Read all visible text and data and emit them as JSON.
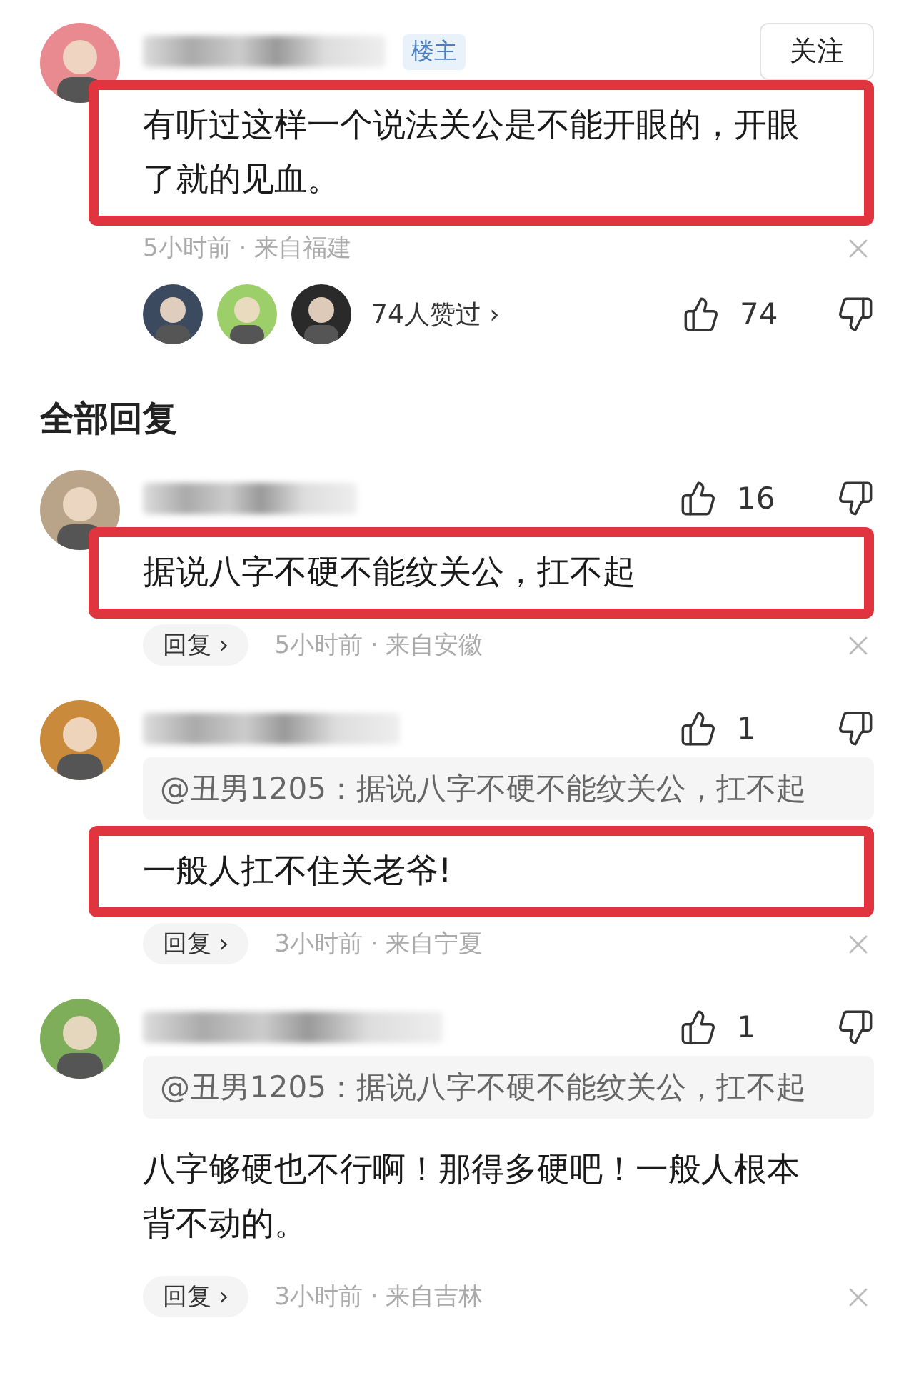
{
  "post": {
    "badge": "楼主",
    "follow_button": "关注",
    "text": "有听过这样一个说法关公是不能开眼的，开眼了就的见血。",
    "highlighted": true,
    "meta": "5小时前 · 来自福建",
    "likers_text": "74人赞过 ›",
    "likes": "74"
  },
  "section_title": "全部回复",
  "replies": [
    {
      "likes": "16",
      "text": "据说八字不硬不能纹关公，扛不起",
      "highlighted": true,
      "reply_button": "回复 ›",
      "meta": "5小时前 · 来自安徽"
    },
    {
      "likes": "1",
      "quote": "@丑男1205：据说八字不硬不能纹关公，扛不起",
      "text": "一般人扛不住关老爷!",
      "highlighted": true,
      "reply_button": "回复 ›",
      "meta": "3小时前 · 来自宁夏"
    },
    {
      "likes": "1",
      "quote": "@丑男1205：据说八字不硬不能纹关公，扛不起",
      "text": "八字够硬也不行啊！那得多硬吧！一般人根本背不动的。",
      "highlighted": false,
      "reply_button": "回复 ›",
      "meta": "3小时前 · 来自吉林"
    }
  ]
}
